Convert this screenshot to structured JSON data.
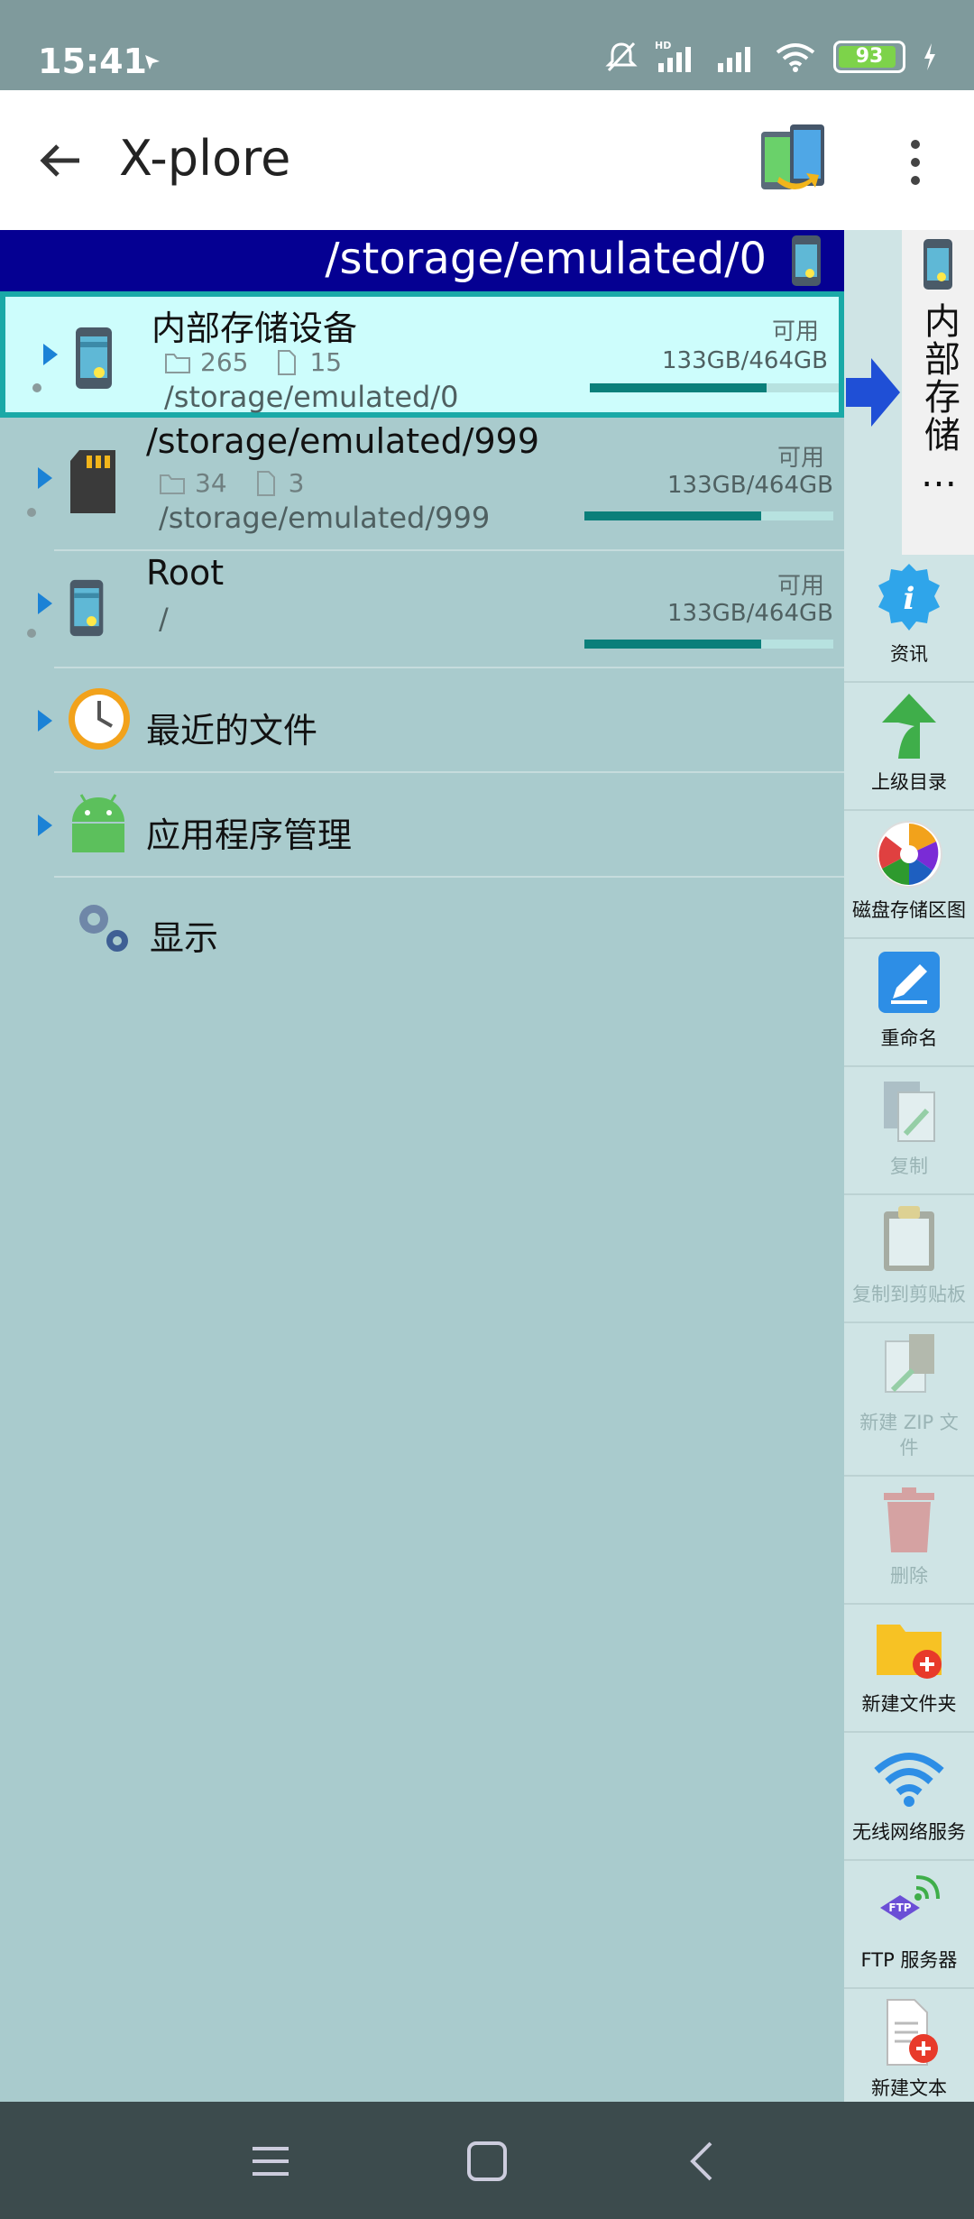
{
  "status_bar": {
    "time": "15:41",
    "battery": "93",
    "icons": [
      "notification-icon",
      "mute-icon",
      "hd-signal-icon",
      "signal-icon",
      "wifi-icon",
      "battery-icon",
      "charging-icon"
    ]
  },
  "app_bar": {
    "title": "X-plore",
    "back_icon": "back-arrow-icon",
    "swap_icon": "dual-pane-swap-icon",
    "menu_icon": "more-vert-icon"
  },
  "path_header": {
    "path": "/storage/emulated/0"
  },
  "drawer_tab": {
    "label": "内部存储…"
  },
  "list": [
    {
      "name": "内部存储设备",
      "folders": "265",
      "files": "15",
      "path": "/storage/emulated/0",
      "avail_label": "可用",
      "size": "133GB/464GB",
      "used_fraction": 0.71,
      "icon": "phone-icon",
      "selected": true
    },
    {
      "name": "/storage/emulated/999",
      "folders": "34",
      "files": "3",
      "path": "/storage/emulated/999",
      "avail_label": "可用",
      "size": "133GB/464GB",
      "used_fraction": 0.71,
      "icon": "sd-card-icon",
      "selected": false
    },
    {
      "name": "Root",
      "path": "/",
      "avail_label": "可用",
      "size": "133GB/464GB",
      "used_fraction": 0.71,
      "icon": "phone-icon",
      "selected": false
    },
    {
      "name": "最近的文件",
      "icon": "clock-icon"
    },
    {
      "name": "应用程序管理",
      "icon": "android-icon"
    },
    {
      "name": "显示",
      "icon": "gears-icon"
    }
  ],
  "toolbar": [
    {
      "label": "资讯",
      "icon": "info-icon",
      "enabled": true
    },
    {
      "label": "上级目录",
      "icon": "up-arrow-icon",
      "enabled": true
    },
    {
      "label": "磁盘存储区图",
      "icon": "pie-chart-icon",
      "enabled": true
    },
    {
      "label": "重命名",
      "icon": "rename-icon",
      "enabled": true
    },
    {
      "label": "复制",
      "icon": "copy-icon",
      "enabled": false
    },
    {
      "label": "复制到剪贴板",
      "icon": "clipboard-icon",
      "enabled": false
    },
    {
      "label": "新建 ZIP 文件",
      "icon": "zip-icon",
      "enabled": false
    },
    {
      "label": "删除",
      "icon": "trash-icon",
      "enabled": false
    },
    {
      "label": "新建文件夹",
      "icon": "new-folder-icon",
      "enabled": true
    },
    {
      "label": "无线网络服务",
      "icon": "wifi-icon",
      "enabled": true
    },
    {
      "label": "FTP 服务器",
      "icon": "ftp-icon",
      "enabled": true
    },
    {
      "label": "新建文本",
      "icon": "new-text-icon",
      "enabled": true
    }
  ],
  "nav_bar": {
    "icons": [
      "menu-icon",
      "home-icon",
      "back-icon"
    ]
  },
  "colors": {
    "status_bar": "#7f9a9c",
    "path_header": "#050092",
    "list_background": "#a9cbcd",
    "selected_row": "#cdfdfc",
    "selected_border": "#1aa9a7",
    "usage_bar": "#0a7f7a",
    "nav_bar": "#3c4b4d"
  }
}
